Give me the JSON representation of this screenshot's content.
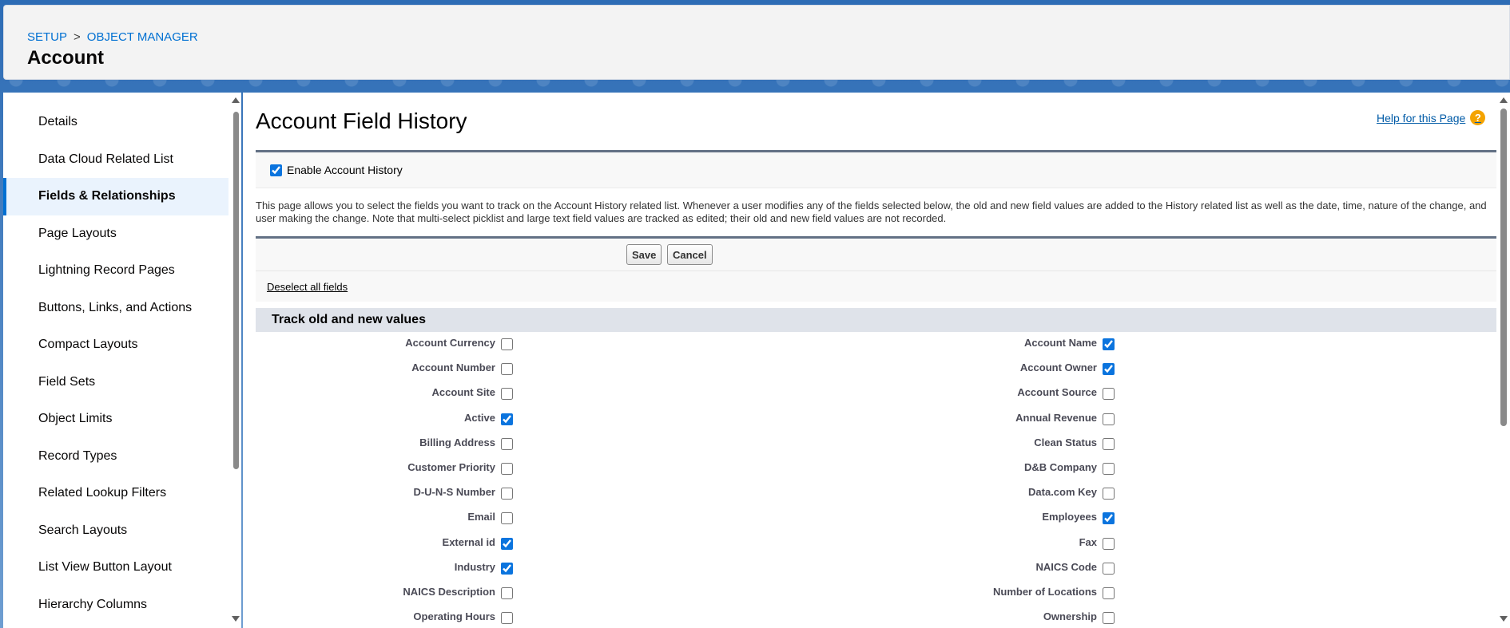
{
  "header": {
    "breadcrumb": [
      "SETUP",
      "OBJECT MANAGER"
    ],
    "breadcrumb_separator": ">",
    "title": "Account"
  },
  "sidebar": {
    "items": [
      {
        "label": "Details",
        "active": false
      },
      {
        "label": "Data Cloud Related List",
        "active": false
      },
      {
        "label": "Fields & Relationships",
        "active": true
      },
      {
        "label": "Page Layouts",
        "active": false
      },
      {
        "label": "Lightning Record Pages",
        "active": false
      },
      {
        "label": "Buttons, Links, and Actions",
        "active": false
      },
      {
        "label": "Compact Layouts",
        "active": false
      },
      {
        "label": "Field Sets",
        "active": false
      },
      {
        "label": "Object Limits",
        "active": false
      },
      {
        "label": "Record Types",
        "active": false
      },
      {
        "label": "Related Lookup Filters",
        "active": false
      },
      {
        "label": "Search Layouts",
        "active": false
      },
      {
        "label": "List View Button Layout",
        "active": false
      },
      {
        "label": "Hierarchy Columns",
        "active": false
      }
    ]
  },
  "main": {
    "title": "Account Field History",
    "help_label": "Help for this Page",
    "enable_label": "Enable Account History",
    "enable_checked": true,
    "description": "This page allows you to select the fields you want to track on the Account History related list. Whenever a user modifies any of the fields selected below, the old and new field values are added to the History related list as well as the date, time, nature of the change, and user making the change. Note that multi-select picklist and large text field values are tracked as edited; their old and new field values are not recorded.",
    "save_label": "Save",
    "cancel_label": "Cancel",
    "deselect_label": "Deselect all fields",
    "section_title": "Track old and new values",
    "fields": [
      {
        "left": {
          "label": "Account Currency",
          "checked": false
        },
        "right": {
          "label": "Account Name",
          "checked": true
        }
      },
      {
        "left": {
          "label": "Account Number",
          "checked": false
        },
        "right": {
          "label": "Account Owner",
          "checked": true
        }
      },
      {
        "left": {
          "label": "Account Site",
          "checked": false
        },
        "right": {
          "label": "Account Source",
          "checked": false
        }
      },
      {
        "left": {
          "label": "Active",
          "checked": true
        },
        "right": {
          "label": "Annual Revenue",
          "checked": false
        }
      },
      {
        "left": {
          "label": "Billing Address",
          "checked": false
        },
        "right": {
          "label": "Clean Status",
          "checked": false
        }
      },
      {
        "left": {
          "label": "Customer Priority",
          "checked": false
        },
        "right": {
          "label": "D&B Company",
          "checked": false
        }
      },
      {
        "left": {
          "label": "D-U-N-S Number",
          "checked": false
        },
        "right": {
          "label": "Data.com Key",
          "checked": false
        }
      },
      {
        "left": {
          "label": "Email",
          "checked": false
        },
        "right": {
          "label": "Employees",
          "checked": true
        }
      },
      {
        "left": {
          "label": "External id",
          "checked": true
        },
        "right": {
          "label": "Fax",
          "checked": false
        }
      },
      {
        "left": {
          "label": "Industry",
          "checked": true
        },
        "right": {
          "label": "NAICS Code",
          "checked": false
        }
      },
      {
        "left": {
          "label": "NAICS Description",
          "checked": false
        },
        "right": {
          "label": "Number of Locations",
          "checked": false
        }
      },
      {
        "left": {
          "label": "Operating Hours",
          "checked": false
        },
        "right": {
          "label": "Ownership",
          "checked": false
        }
      }
    ]
  },
  "colors": {
    "link": "#0070d2",
    "active_nav_bg": "#eaf3fd",
    "section_bg": "#dfe3ea",
    "help_icon": "#f4a300"
  }
}
